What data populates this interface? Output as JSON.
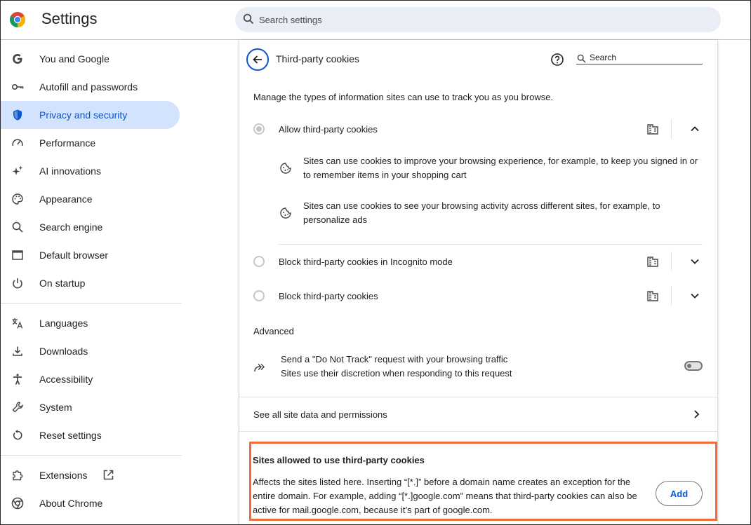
{
  "app": {
    "title": "Settings"
  },
  "search": {
    "placeholder": "Search settings"
  },
  "sidebar": {
    "items": [
      {
        "label": "You and Google",
        "icon": "google-g-icon"
      },
      {
        "label": "Autofill and passwords",
        "icon": "key-icon"
      },
      {
        "label": "Privacy and security",
        "icon": "shield-icon",
        "active": true
      },
      {
        "label": "Performance",
        "icon": "speedometer-icon"
      },
      {
        "label": "AI innovations",
        "icon": "sparkle-icon"
      },
      {
        "label": "Appearance",
        "icon": "palette-icon"
      },
      {
        "label": "Search engine",
        "icon": "search-icon"
      },
      {
        "label": "Default browser",
        "icon": "browser-window-icon"
      },
      {
        "label": "On startup",
        "icon": "power-icon"
      },
      {
        "label": "Languages",
        "icon": "translate-icon"
      },
      {
        "label": "Downloads",
        "icon": "download-icon"
      },
      {
        "label": "Accessibility",
        "icon": "accessibility-icon"
      },
      {
        "label": "System",
        "icon": "wrench-icon"
      },
      {
        "label": "Reset settings",
        "icon": "reset-icon"
      },
      {
        "label": "Extensions",
        "icon": "puzzle-icon"
      },
      {
        "label": "About Chrome",
        "icon": "chrome-icon"
      }
    ]
  },
  "page": {
    "title": "Third-party cookies",
    "search_placeholder": "Search",
    "description": "Manage the types of information sites can use to track you as you browse.",
    "options": [
      {
        "label": "Allow third-party cookies",
        "selected": true,
        "expanded": true,
        "details": [
          "Sites can use cookies to improve your browsing experience, for example, to keep you signed in or to remember items in your shopping cart",
          "Sites can use cookies to see your browsing activity across different sites, for example, to personalize ads"
        ]
      },
      {
        "label": "Block third-party cookies in Incognito mode",
        "selected": false,
        "expanded": false
      },
      {
        "label": "Block third-party cookies",
        "selected": false,
        "expanded": false
      }
    ],
    "advanced": {
      "heading": "Advanced",
      "dnt_title": "Send a \"Do Not Track\" request with your browsing traffic",
      "dnt_subtitle": "Sites use their discretion when responding to this request",
      "dnt_enabled": false
    },
    "see_all": "See all site data and permissions",
    "allowed_section": {
      "title": "Sites allowed to use third-party cookies",
      "description": "Affects the sites listed here. Inserting “[*.]” before a domain name creates an exception for the entire domain. For example, adding “[*.]google.com” means that third-party cookies can also be active for mail.google.com, because it’s part of google.com.",
      "add_label": "Add"
    }
  },
  "colors": {
    "accent": "#0b57d0",
    "active_nav_bg": "#d3e3fd",
    "highlight_border": "#f26b3a"
  }
}
